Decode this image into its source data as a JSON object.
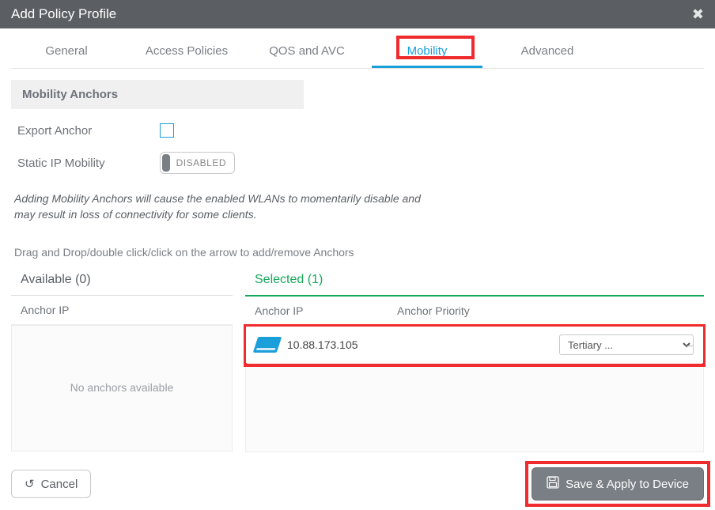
{
  "header": {
    "title": "Add Policy Profile"
  },
  "tabs": {
    "general": "General",
    "access_policies": "Access Policies",
    "qos_avc": "QOS and AVC",
    "mobility": "Mobility",
    "advanced": "Advanced"
  },
  "section": {
    "mobility_anchors": "Mobility Anchors"
  },
  "form": {
    "export_anchor_label": "Export Anchor",
    "static_ip_label": "Static IP Mobility",
    "disabled_text": "DISABLED"
  },
  "note": "Adding Mobility Anchors will cause the enabled WLANs to momentarily disable and may result in loss of connectivity for some clients.",
  "hint": "Drag and Drop/double click/click on the arrow to add/remove Anchors",
  "available": {
    "heading": "Available (0)",
    "col_anchor_ip": "Anchor IP",
    "empty": "No anchors available"
  },
  "selected": {
    "heading": "Selected (1)",
    "col_anchor_ip": "Anchor IP",
    "col_anchor_priority": "Anchor Priority",
    "rows": [
      {
        "ip": "10.88.173.105",
        "priority": "Tertiary ..."
      }
    ]
  },
  "footer": {
    "cancel": "Cancel",
    "save": "Save & Apply to Device"
  }
}
